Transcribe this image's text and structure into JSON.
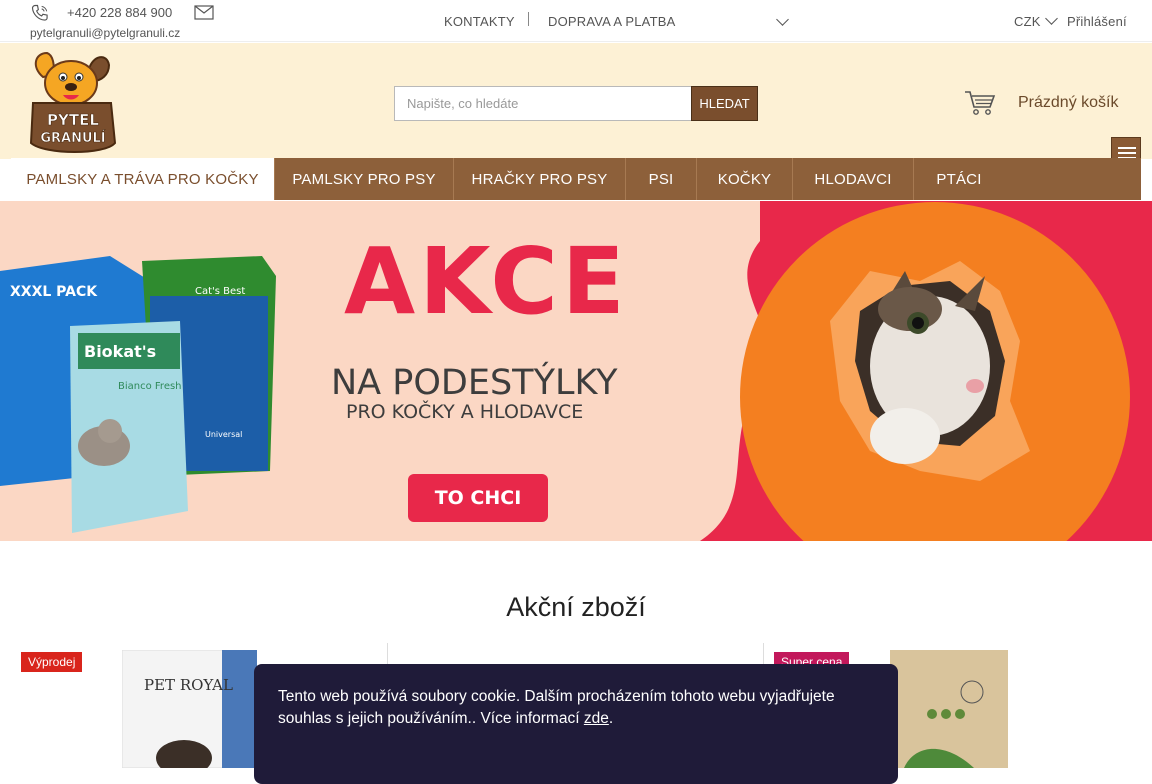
{
  "topbar": {
    "phone": "+420 228 884 900",
    "email": "pytelgranuli@pytelgranuli.cz",
    "links": [
      "KONTAKTY",
      "DOPRAVA A PLATBA"
    ],
    "currency": "CZK",
    "login": "Přihlášení"
  },
  "header": {
    "logo_text": [
      "PYTEL",
      "GRANULÍ"
    ],
    "search_placeholder": "Napište, co hledáte",
    "search_button": "HLEDAT",
    "cart_label": "Prázdný košík"
  },
  "nav": {
    "items": [
      "PAMLSKY A TRÁVA PRO KOČKY",
      "PAMLSKY PRO PSY",
      "HRAČKY PRO PSY",
      "PSI",
      "KOČKY",
      "HLODAVCI",
      "PTÁCI"
    ]
  },
  "banner": {
    "headline": "AKCE",
    "line1": "NA PODESTÝLKY",
    "line2": "PRO KOČKY A HLODAVCE",
    "cta": "TO CHCI",
    "products": [
      "XXXL PACK",
      "Biokat's",
      "Bianco Fresh",
      "Cat's Best",
      "Universal"
    ]
  },
  "section": {
    "title": "Akční zboží",
    "badges": [
      "Výprodej",
      "Super cena"
    ],
    "product_brands": [
      "PET ROYAL"
    ]
  },
  "cookie": {
    "text": "Tento web používá soubory cookie. Dalším procházením tohoto webu vyjadřujete souhlas s jejich používáním.. Více informací",
    "link": "zde",
    "end": "."
  },
  "colors": {
    "brand_brown": "#8d603a",
    "header_bg": "#fdf1d5",
    "banner_bg": "#fbd7c4",
    "accent_red": "#e8284a",
    "cookie_bg": "#1f1b39"
  }
}
